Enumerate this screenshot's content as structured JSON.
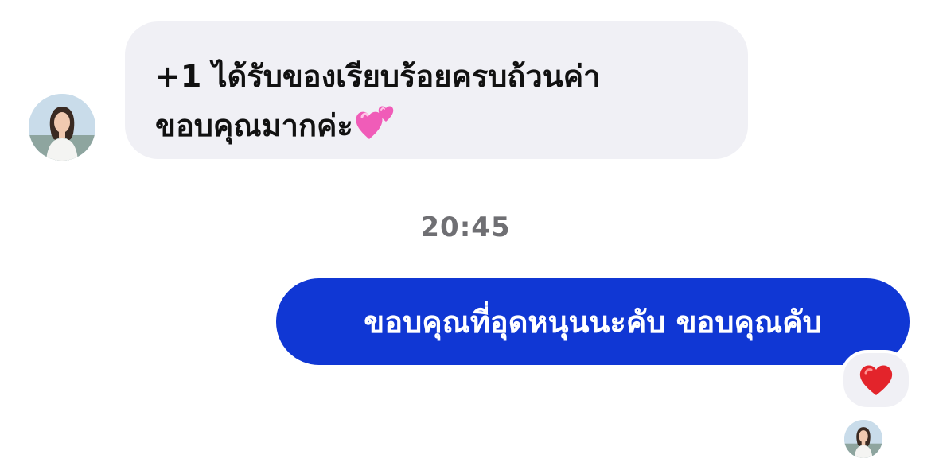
{
  "thread": {
    "incoming": {
      "line1": "+1 ได้รับของเรียบร้อยครบถ้วนค่า",
      "line2": "ขอบคุณมากค่ะ",
      "emoji": "two-hearts-icon"
    },
    "timestamp": "20:45",
    "outgoing": {
      "text": "ขอบคุณที่อุดหนุนนะคับ ขอบคุณคับ",
      "reaction": "red-heart-icon"
    }
  },
  "colors": {
    "incoming_bubble": "#f0f0f5",
    "outgoing_bubble": "#1037d4",
    "timestamp": "#6f6f73",
    "heart": "#e3242b",
    "pink_heart": "#f05cb8"
  }
}
